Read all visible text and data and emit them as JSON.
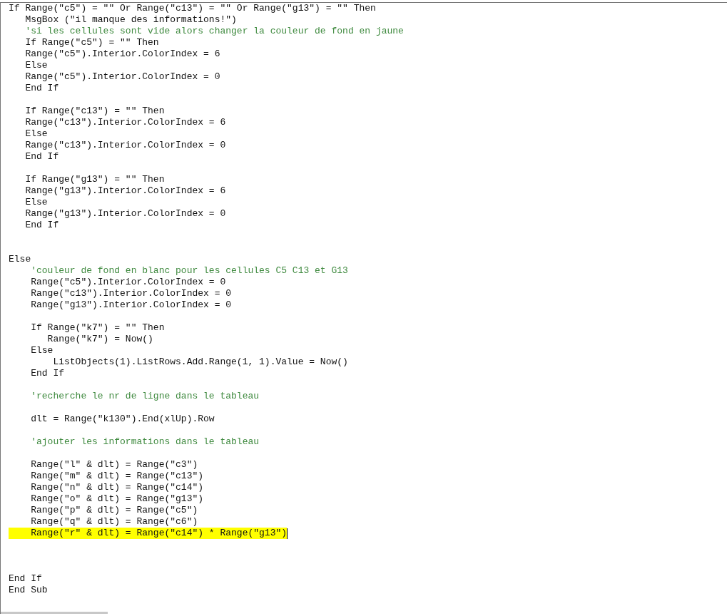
{
  "editor": {
    "lines": [
      {
        "kind": "code",
        "text": "If Range(\"c5\") = \"\" Or Range(\"c13\") = \"\" Or Range(\"g13\") = \"\" Then",
        "highlighted": false,
        "cursor": false
      },
      {
        "kind": "code",
        "text": "   MsgBox (\"il manque des informations!\")",
        "highlighted": false,
        "cursor": false
      },
      {
        "kind": "comment",
        "text": "   'si les cellules sont vide alors changer la couleur de fond en jaune",
        "highlighted": false,
        "cursor": false
      },
      {
        "kind": "code",
        "text": "   If Range(\"c5\") = \"\" Then",
        "highlighted": false,
        "cursor": false
      },
      {
        "kind": "code",
        "text": "   Range(\"c5\").Interior.ColorIndex = 6",
        "highlighted": false,
        "cursor": false
      },
      {
        "kind": "code",
        "text": "   Else",
        "highlighted": false,
        "cursor": false
      },
      {
        "kind": "code",
        "text": "   Range(\"c5\").Interior.ColorIndex = 0",
        "highlighted": false,
        "cursor": false
      },
      {
        "kind": "code",
        "text": "   End If",
        "highlighted": false,
        "cursor": false
      },
      {
        "kind": "blank"
      },
      {
        "kind": "code",
        "text": "   If Range(\"c13\") = \"\" Then",
        "highlighted": false,
        "cursor": false
      },
      {
        "kind": "code",
        "text": "   Range(\"c13\").Interior.ColorIndex = 6",
        "highlighted": false,
        "cursor": false
      },
      {
        "kind": "code",
        "text": "   Else",
        "highlighted": false,
        "cursor": false
      },
      {
        "kind": "code",
        "text": "   Range(\"c13\").Interior.ColorIndex = 0",
        "highlighted": false,
        "cursor": false
      },
      {
        "kind": "code",
        "text": "   End If",
        "highlighted": false,
        "cursor": false
      },
      {
        "kind": "blank"
      },
      {
        "kind": "code",
        "text": "   If Range(\"g13\") = \"\" Then",
        "highlighted": false,
        "cursor": false
      },
      {
        "kind": "code",
        "text": "   Range(\"g13\").Interior.ColorIndex = 6",
        "highlighted": false,
        "cursor": false
      },
      {
        "kind": "code",
        "text": "   Else",
        "highlighted": false,
        "cursor": false
      },
      {
        "kind": "code",
        "text": "   Range(\"g13\").Interior.ColorIndex = 0",
        "highlighted": false,
        "cursor": false
      },
      {
        "kind": "code",
        "text": "   End If",
        "highlighted": false,
        "cursor": false
      },
      {
        "kind": "blank"
      },
      {
        "kind": "blank"
      },
      {
        "kind": "code",
        "text": "Else",
        "highlighted": false,
        "cursor": false
      },
      {
        "kind": "comment",
        "text": "    'couleur de fond en blanc pour les cellules C5 C13 et G13",
        "highlighted": false,
        "cursor": false
      },
      {
        "kind": "code",
        "text": "    Range(\"c5\").Interior.ColorIndex = 0",
        "highlighted": false,
        "cursor": false
      },
      {
        "kind": "code",
        "text": "    Range(\"c13\").Interior.ColorIndex = 0",
        "highlighted": false,
        "cursor": false
      },
      {
        "kind": "code",
        "text": "    Range(\"g13\").Interior.ColorIndex = 0",
        "highlighted": false,
        "cursor": false
      },
      {
        "kind": "blank"
      },
      {
        "kind": "code",
        "text": "    If Range(\"k7\") = \"\" Then",
        "highlighted": false,
        "cursor": false
      },
      {
        "kind": "code",
        "text": "       Range(\"k7\") = Now()",
        "highlighted": false,
        "cursor": false
      },
      {
        "kind": "code",
        "text": "    Else",
        "highlighted": false,
        "cursor": false
      },
      {
        "kind": "code",
        "text": "        ListObjects(1).ListRows.Add.Range(1, 1).Value = Now()",
        "highlighted": false,
        "cursor": false
      },
      {
        "kind": "code",
        "text": "    End If",
        "highlighted": false,
        "cursor": false
      },
      {
        "kind": "blank"
      },
      {
        "kind": "comment",
        "text": "    'recherche le nr de ligne dans le tableau",
        "highlighted": false,
        "cursor": false
      },
      {
        "kind": "blank"
      },
      {
        "kind": "code",
        "text": "    dlt = Range(\"k130\").End(xlUp).Row",
        "highlighted": false,
        "cursor": false
      },
      {
        "kind": "blank"
      },
      {
        "kind": "comment",
        "text": "    'ajouter les informations dans le tableau",
        "highlighted": false,
        "cursor": false
      },
      {
        "kind": "blank"
      },
      {
        "kind": "code",
        "text": "    Range(\"l\" & dlt) = Range(\"c3\")",
        "highlighted": false,
        "cursor": false
      },
      {
        "kind": "code",
        "text": "    Range(\"m\" & dlt) = Range(\"c13\")",
        "highlighted": false,
        "cursor": false
      },
      {
        "kind": "code",
        "text": "    Range(\"n\" & dlt) = Range(\"c14\")",
        "highlighted": false,
        "cursor": false
      },
      {
        "kind": "code",
        "text": "    Range(\"o\" & dlt) = Range(\"g13\")",
        "highlighted": false,
        "cursor": false
      },
      {
        "kind": "code",
        "text": "    Range(\"p\" & dlt) = Range(\"c5\")",
        "highlighted": false,
        "cursor": false
      },
      {
        "kind": "code",
        "text": "    Range(\"q\" & dlt) = Range(\"c6\")",
        "highlighted": false,
        "cursor": false
      },
      {
        "kind": "code",
        "text": "    Range(\"r\" & dlt) = Range(\"c14\") * Range(\"g13\")",
        "highlighted": true,
        "cursor": true
      },
      {
        "kind": "blank"
      },
      {
        "kind": "blank"
      },
      {
        "kind": "blank"
      },
      {
        "kind": "code",
        "text": "End If",
        "highlighted": false,
        "cursor": false
      },
      {
        "kind": "code",
        "text": "End Sub",
        "highlighted": false,
        "cursor": false
      }
    ]
  }
}
